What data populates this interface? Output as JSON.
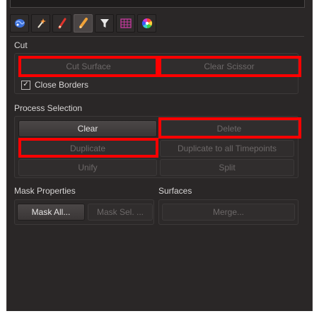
{
  "toolbar": {
    "tools": [
      {
        "icon": "brain-icon"
      },
      {
        "icon": "magic-wand-icon"
      },
      {
        "icon": "red-pencil-icon"
      },
      {
        "icon": "pencil-icon",
        "active": true
      },
      {
        "icon": "filter-icon"
      },
      {
        "icon": "grid-icon"
      },
      {
        "icon": "color-wheel-icon"
      }
    ]
  },
  "cut": {
    "title": "Cut",
    "cut_surface_label": "Cut Surface",
    "clear_scissor_label": "Clear Scissor",
    "close_borders_label": "Close Borders",
    "close_borders_checked": true
  },
  "process": {
    "title": "Process Selection",
    "clear_label": "Clear",
    "delete_label": "Delete",
    "duplicate_label": "Duplicate",
    "duplicate_all_label": "Duplicate to all Timepoints",
    "unify_label": "Unify",
    "split_label": "Split"
  },
  "mask": {
    "title": "Mask Properties",
    "mask_all_label": "Mask All...",
    "mask_sel_label": "Mask Sel. ..."
  },
  "surfaces": {
    "title": "Surfaces",
    "merge_label": "Merge..."
  },
  "colors": {
    "panel_bg": "#2a2727",
    "highlight": "#ff0000",
    "enabled_text": "#e6e4e4",
    "disabled_text": "#6c6868"
  }
}
